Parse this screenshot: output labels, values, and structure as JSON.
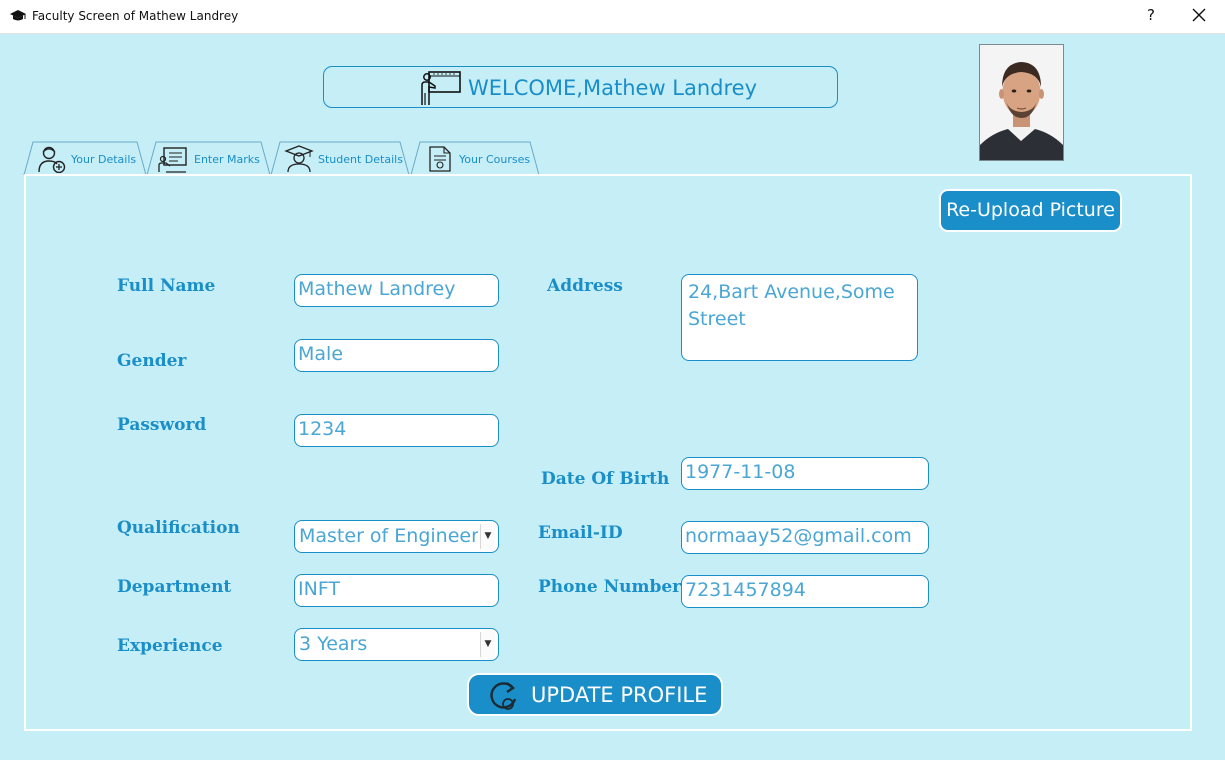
{
  "window": {
    "title": "Faculty Screen of Mathew Landrey",
    "help_label": "?",
    "app_icon": "graduation-cap-icon",
    "close_icon": "close-icon"
  },
  "header": {
    "welcome_text": "WELCOME,Mathew Landrey",
    "welcome_icon": "teacher-board-icon",
    "photo": "faculty-photo"
  },
  "tabs": [
    {
      "label": "Your Details",
      "icon": "user-add-icon",
      "selected": true
    },
    {
      "label": "Enter Marks",
      "icon": "presentation-board-icon",
      "selected": false
    },
    {
      "label": "Student Details",
      "icon": "student-graduate-icon",
      "selected": false
    },
    {
      "label": "Your Courses",
      "icon": "course-document-icon",
      "selected": false
    }
  ],
  "actions": {
    "reupload_label": "Re-Upload Picture",
    "update_label": "UPDATE PROFILE",
    "update_icon": "refresh-icon"
  },
  "form": {
    "full_name": {
      "label": "Full Name",
      "value": "Mathew Landrey"
    },
    "gender": {
      "label": "Gender",
      "value": "Male"
    },
    "password": {
      "label": "Password",
      "value": "1234"
    },
    "qualification": {
      "label": "Qualification",
      "value": "Master of Engineeri"
    },
    "department": {
      "label": "Department",
      "value": "INFT"
    },
    "experience": {
      "label": "Experience",
      "value": "3 Years"
    },
    "address": {
      "label": "Address",
      "value": "24,Bart Avenue,Some Street"
    },
    "dob": {
      "label": "Date Of Birth",
      "value": "1977-11-08"
    },
    "email": {
      "label": "Email-ID",
      "value": "normaay52@gmail.com"
    },
    "phone": {
      "label": "Phone Number",
      "value": "7231457894"
    }
  },
  "colors": {
    "background": "#c5eef6",
    "accent": "#1a8ec9",
    "field_text": "#4aa6d4",
    "white": "#ffffff"
  }
}
